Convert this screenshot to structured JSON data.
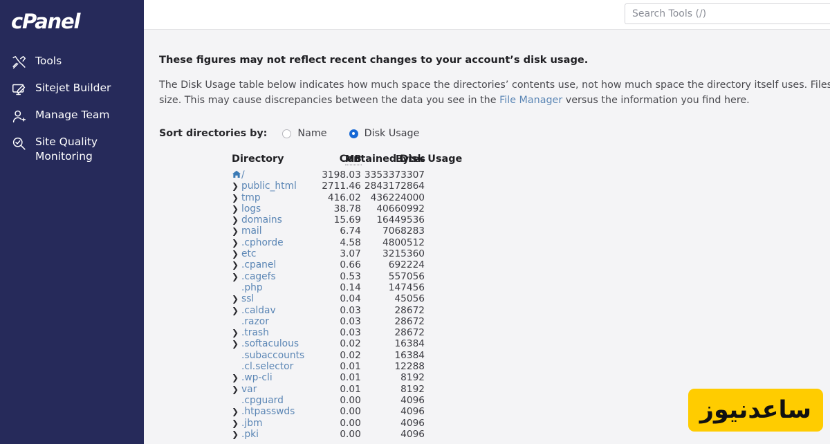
{
  "sidebar": {
    "brand": "cPanel",
    "items": [
      {
        "label": "Tools",
        "icon": "tools-icon"
      },
      {
        "label": "Sitejet Builder",
        "icon": "monitor-pen-icon"
      },
      {
        "label": "Manage Team",
        "icon": "user-plus-icon"
      },
      {
        "label": "Site Quality Monitoring",
        "icon": "magnifier-check-icon"
      }
    ]
  },
  "topbar": {
    "search_placeholder": "Search Tools (/)",
    "search_value": ""
  },
  "notice": {
    "title": "These figures may not reflect recent changes to your account’s disk usage.",
    "body_part1": "The Disk Usage table below indicates how much space the directories’ contents use, not how much space the directory itself uses. Files typically occupy more disk spac",
    "body_part2_pre": "size. This may cause discrepancies between the data you see in the ",
    "body_link": "File Manager",
    "body_part2_post": " versus the information you find here."
  },
  "sort": {
    "label": "Sort directories by:",
    "options": [
      {
        "label": "Name",
        "selected": false
      },
      {
        "label": "Disk Usage",
        "selected": true
      }
    ]
  },
  "table": {
    "group_header": "Contained Disk Usage",
    "col_directory": "Directory",
    "col_mb": "MB",
    "col_bytes": "Bytes",
    "rows": [
      {
        "name": "/",
        "mb": "3198.03",
        "bytes": "3353373307",
        "expandable": false,
        "home": true
      },
      {
        "name": "public_html",
        "mb": "2711.46",
        "bytes": "2843172864",
        "expandable": true,
        "home": false
      },
      {
        "name": "tmp",
        "mb": "416.02",
        "bytes": "436224000",
        "expandable": true,
        "home": false
      },
      {
        "name": "logs",
        "mb": "38.78",
        "bytes": "40660992",
        "expandable": true,
        "home": false
      },
      {
        "name": "domains",
        "mb": "15.69",
        "bytes": "16449536",
        "expandable": true,
        "home": false
      },
      {
        "name": "mail",
        "mb": "6.74",
        "bytes": "7068283",
        "expandable": true,
        "home": false
      },
      {
        "name": ".cphorde",
        "mb": "4.58",
        "bytes": "4800512",
        "expandable": true,
        "home": false
      },
      {
        "name": "etc",
        "mb": "3.07",
        "bytes": "3215360",
        "expandable": true,
        "home": false
      },
      {
        "name": ".cpanel",
        "mb": "0.66",
        "bytes": "692224",
        "expandable": true,
        "home": false
      },
      {
        "name": ".cagefs",
        "mb": "0.53",
        "bytes": "557056",
        "expandable": true,
        "home": false
      },
      {
        "name": ".php",
        "mb": "0.14",
        "bytes": "147456",
        "expandable": false,
        "home": false
      },
      {
        "name": "ssl",
        "mb": "0.04",
        "bytes": "45056",
        "expandable": true,
        "home": false
      },
      {
        "name": ".caldav",
        "mb": "0.03",
        "bytes": "28672",
        "expandable": true,
        "home": false
      },
      {
        "name": ".razor",
        "mb": "0.03",
        "bytes": "28672",
        "expandable": false,
        "home": false
      },
      {
        "name": ".trash",
        "mb": "0.03",
        "bytes": "28672",
        "expandable": true,
        "home": false
      },
      {
        "name": ".softaculous",
        "mb": "0.02",
        "bytes": "16384",
        "expandable": true,
        "home": false
      },
      {
        "name": ".subaccounts",
        "mb": "0.02",
        "bytes": "16384",
        "expandable": false,
        "home": false
      },
      {
        "name": ".cl.selector",
        "mb": "0.01",
        "bytes": "12288",
        "expandable": false,
        "home": false
      },
      {
        "name": ".wp-cli",
        "mb": "0.01",
        "bytes": "8192",
        "expandable": true,
        "home": false
      },
      {
        "name": "var",
        "mb": "0.01",
        "bytes": "8192",
        "expandable": true,
        "home": false
      },
      {
        "name": ".cpguard",
        "mb": "0.00",
        "bytes": "4096",
        "expandable": false,
        "home": false
      },
      {
        "name": ".htpasswds",
        "mb": "0.00",
        "bytes": "4096",
        "expandable": true,
        "home": false
      },
      {
        "name": ".jbm",
        "mb": "0.00",
        "bytes": "4096",
        "expandable": true,
        "home": false
      },
      {
        "name": ".pki",
        "mb": "0.00",
        "bytes": "4096",
        "expandable": true,
        "home": false
      }
    ]
  },
  "watermark": {
    "text": "ساعدنیوز",
    "bg_color": "#ffcc00"
  },
  "colors": {
    "sidebar_bg": "#262a5a",
    "link": "#5b86b5",
    "radio_accent": "#1668d6",
    "content_bg": "#f4f4f6"
  }
}
